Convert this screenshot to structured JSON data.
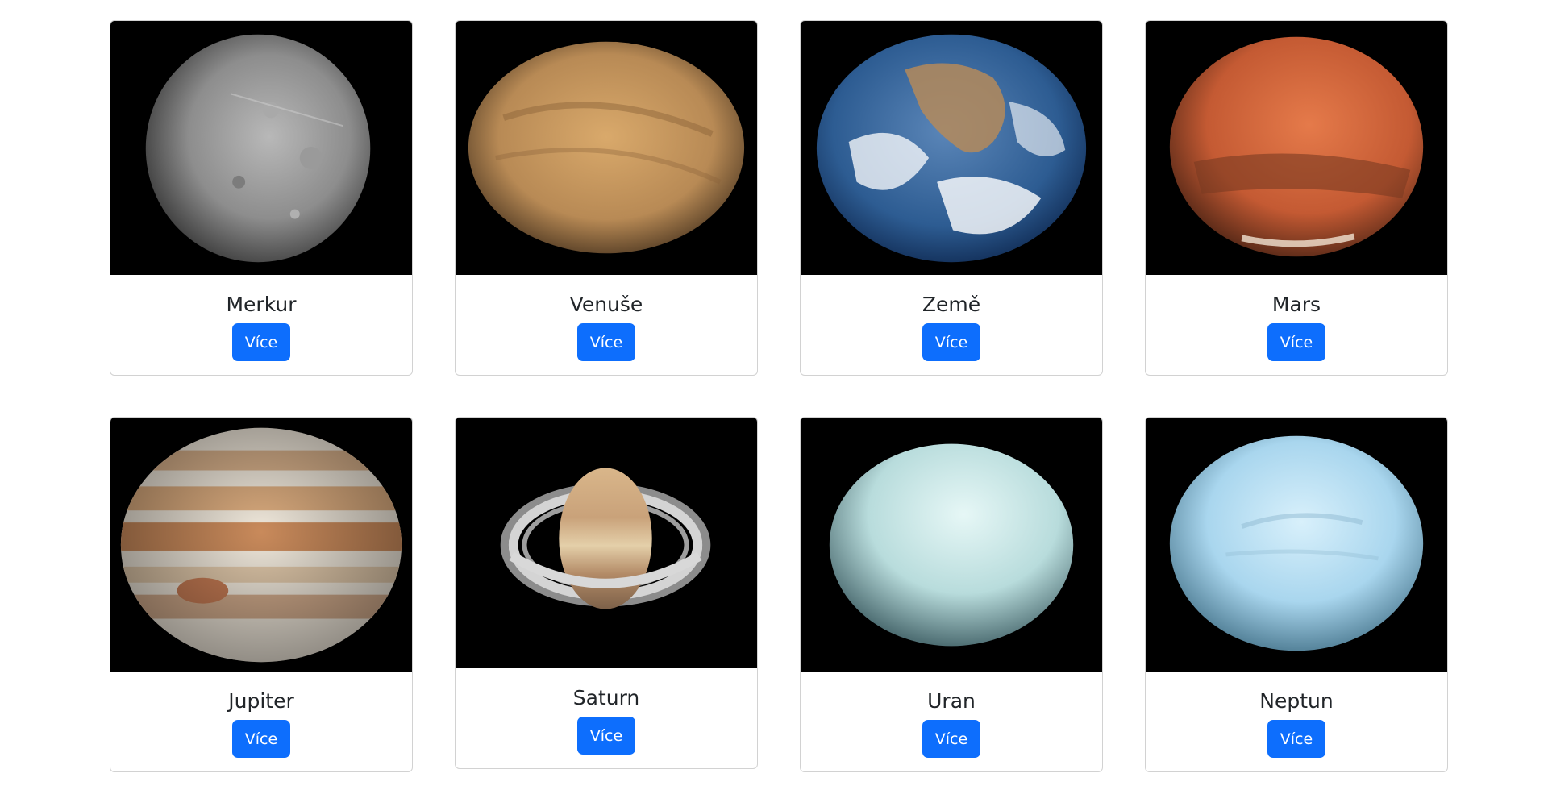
{
  "planets": [
    {
      "name": "Merkur",
      "button": "Více",
      "image": "mercury-image"
    },
    {
      "name": "Venuše",
      "button": "Více",
      "image": "venus-image"
    },
    {
      "name": "Země",
      "button": "Více",
      "image": "earth-image"
    },
    {
      "name": "Mars",
      "button": "Více",
      "image": "mars-image"
    },
    {
      "name": "Jupiter",
      "button": "Více",
      "image": "jupiter-image"
    },
    {
      "name": "Saturn",
      "button": "Více",
      "image": "saturn-image"
    },
    {
      "name": "Uran",
      "button": "Více",
      "image": "uranus-image"
    },
    {
      "name": "Neptun",
      "button": "Více",
      "image": "neptune-image"
    }
  ],
  "colors": {
    "button": "#0d6efd",
    "button_text": "#ffffff",
    "title_text": "#212529",
    "image_background": "#000000"
  }
}
